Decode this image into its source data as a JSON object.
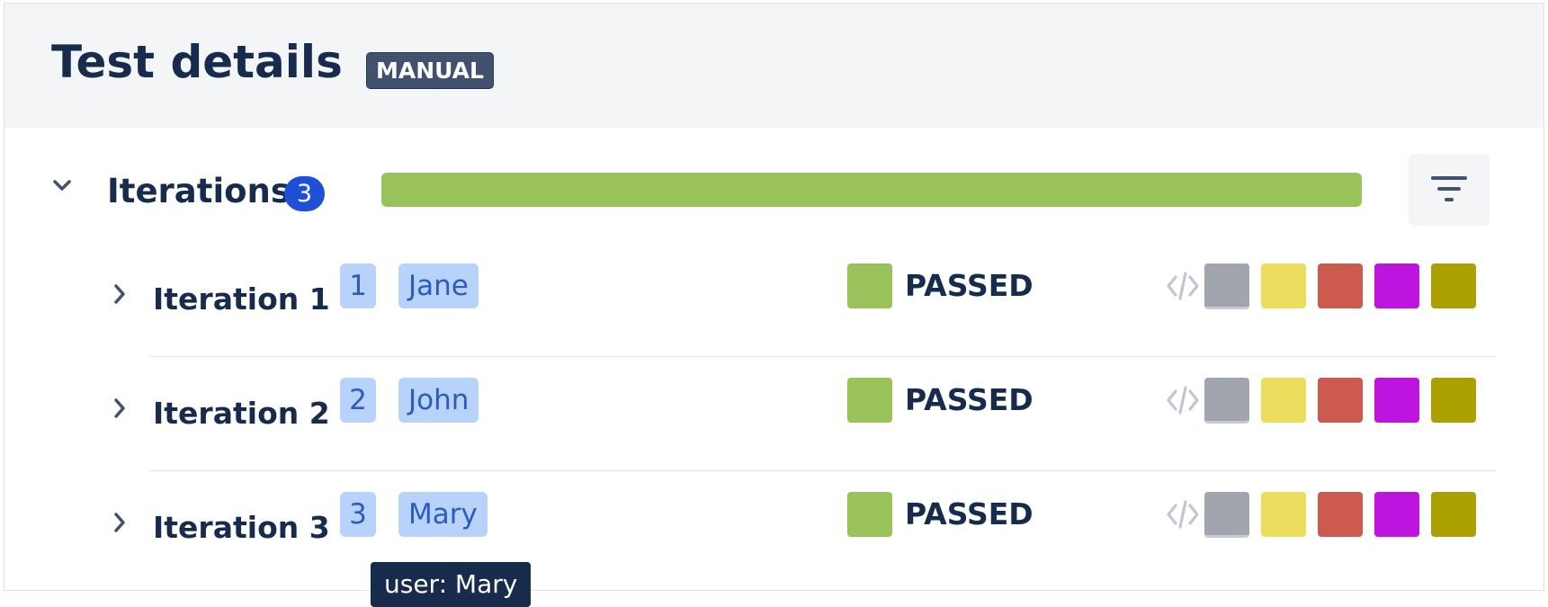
{
  "header": {
    "title": "Test details",
    "badge": "MANUAL"
  },
  "iterations": {
    "label": "Iterations",
    "count": "3",
    "progress_fraction": 1.0,
    "progress_color": "#9ac25b",
    "filter_icon": "filter-icon"
  },
  "rows": [
    {
      "title": "Iteration 1 -",
      "number": "1",
      "user": "Jane",
      "status": "PASSED",
      "status_color": "#9ac25b"
    },
    {
      "title": "Iteration 2 -",
      "number": "2",
      "user": "John",
      "status": "PASSED",
      "status_color": "#9ac25b"
    },
    {
      "title": "Iteration 3 -",
      "number": "3",
      "user": "Mary",
      "status": "PASSED",
      "status_color": "#9ac25b"
    }
  ],
  "swatch_colors": [
    "#a0a5ae",
    "#eddd5e",
    "#cd5a4e",
    "#be14df",
    "#aaa000"
  ],
  "tooltip": {
    "text": "user: Mary"
  }
}
